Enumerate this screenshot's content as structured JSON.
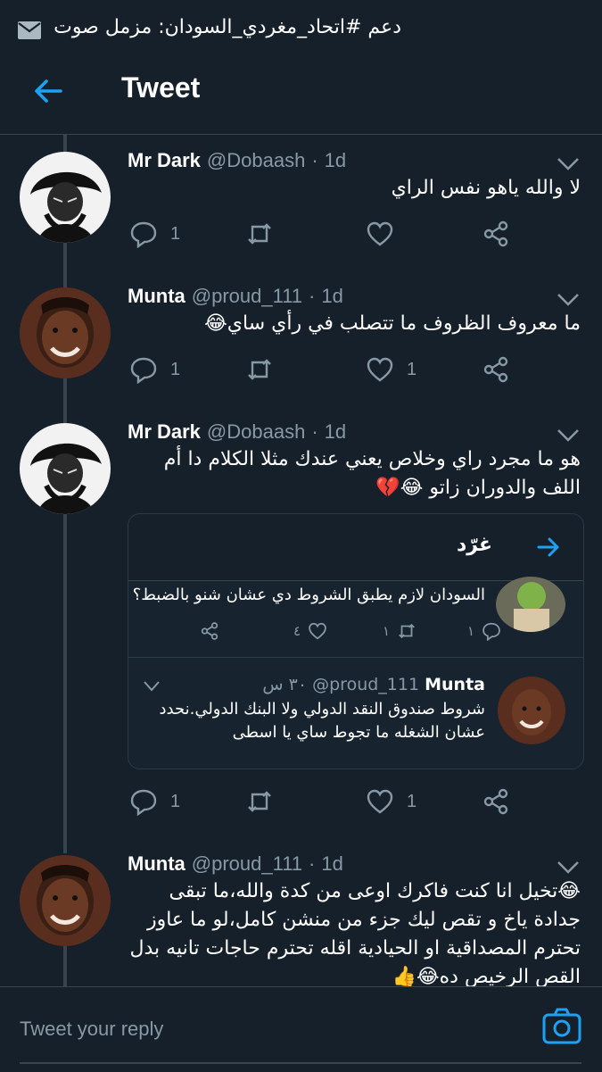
{
  "status_bar": {
    "notification_text": "دعم #اتحاد_مغردي_السودان: مزمل صوت"
  },
  "header": {
    "title": "Tweet"
  },
  "tweets": [
    {
      "name": "Mr Dark",
      "handle": "@Dobaash",
      "dot": "·",
      "time": "1d",
      "text": "لا والله ياهو نفس الراي",
      "reply_count": "1",
      "retweet_count": "",
      "like_count": ""
    },
    {
      "name": "Munta",
      "handle": "@proud_111",
      "dot": "·",
      "time": "1d",
      "text": "ما معروف الظروف ما تتصلب في رأي ساي😂",
      "reply_count": "1",
      "retweet_count": "",
      "like_count": "1"
    },
    {
      "name": "Mr Dark",
      "handle": "@Dobaash",
      "dot": "·",
      "time": "1d",
      "text": "هو ما مجرد راي وخلاص يعني عندك مثلا الكلام دا أم اللف والدوران زاتو 😂💔",
      "reply_count": "1",
      "retweet_count": "",
      "like_count": "1",
      "embed": {
        "title": "غرّد",
        "first": {
          "text": "السودان لازم يطبق الشروط دي عشان شنو بالضبط؟",
          "reply_count": "١",
          "retweet_count": "١",
          "like_count": "٤"
        },
        "second": {
          "name": "Munta",
          "handle": "@proud_111",
          "time": "٣٠ س",
          "text": "شروط صندوق النقد الدولي ولا البنك الدولي.نحدد عشان الشغله ما تجوط ساي يا اسطى"
        }
      }
    },
    {
      "name": "Munta",
      "handle": "@proud_111",
      "dot": "·",
      "time": "1d",
      "text": "😂تخيل انا كنت فاكرك اوعى من كدة والله،ما تبقى جدادة ياخ و تقص ليك جزء من منشن كامل،لو ما عاوز تحترم المصداقية او الحيادية اقله تحترم حاجات تانيه بدل القص الرخيص ده😂👍"
    }
  ],
  "reply": {
    "placeholder": "Tweet your reply"
  },
  "colors": {
    "background": "#15202b",
    "accent": "#1da1f2",
    "muted": "#8899a6",
    "divider": "#38444d"
  }
}
